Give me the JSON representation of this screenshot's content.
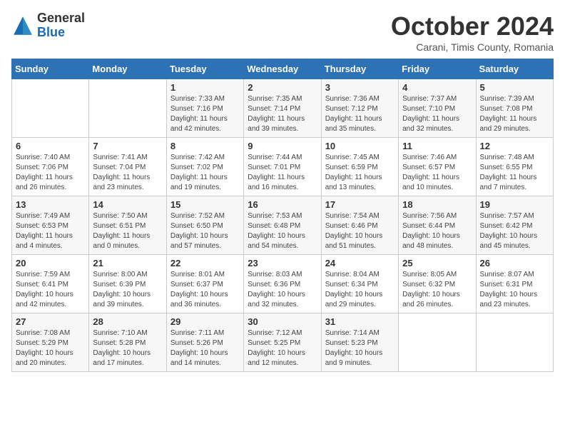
{
  "header": {
    "logo_general": "General",
    "logo_blue": "Blue",
    "title": "October 2024",
    "subtitle": "Carani, Timis County, Romania"
  },
  "days_of_week": [
    "Sunday",
    "Monday",
    "Tuesday",
    "Wednesday",
    "Thursday",
    "Friday",
    "Saturday"
  ],
  "weeks": [
    [
      {
        "num": "",
        "detail": ""
      },
      {
        "num": "",
        "detail": ""
      },
      {
        "num": "1",
        "detail": "Sunrise: 7:33 AM\nSunset: 7:16 PM\nDaylight: 11 hours and 42 minutes."
      },
      {
        "num": "2",
        "detail": "Sunrise: 7:35 AM\nSunset: 7:14 PM\nDaylight: 11 hours and 39 minutes."
      },
      {
        "num": "3",
        "detail": "Sunrise: 7:36 AM\nSunset: 7:12 PM\nDaylight: 11 hours and 35 minutes."
      },
      {
        "num": "4",
        "detail": "Sunrise: 7:37 AM\nSunset: 7:10 PM\nDaylight: 11 hours and 32 minutes."
      },
      {
        "num": "5",
        "detail": "Sunrise: 7:39 AM\nSunset: 7:08 PM\nDaylight: 11 hours and 29 minutes."
      }
    ],
    [
      {
        "num": "6",
        "detail": "Sunrise: 7:40 AM\nSunset: 7:06 PM\nDaylight: 11 hours and 26 minutes."
      },
      {
        "num": "7",
        "detail": "Sunrise: 7:41 AM\nSunset: 7:04 PM\nDaylight: 11 hours and 23 minutes."
      },
      {
        "num": "8",
        "detail": "Sunrise: 7:42 AM\nSunset: 7:02 PM\nDaylight: 11 hours and 19 minutes."
      },
      {
        "num": "9",
        "detail": "Sunrise: 7:44 AM\nSunset: 7:01 PM\nDaylight: 11 hours and 16 minutes."
      },
      {
        "num": "10",
        "detail": "Sunrise: 7:45 AM\nSunset: 6:59 PM\nDaylight: 11 hours and 13 minutes."
      },
      {
        "num": "11",
        "detail": "Sunrise: 7:46 AM\nSunset: 6:57 PM\nDaylight: 11 hours and 10 minutes."
      },
      {
        "num": "12",
        "detail": "Sunrise: 7:48 AM\nSunset: 6:55 PM\nDaylight: 11 hours and 7 minutes."
      }
    ],
    [
      {
        "num": "13",
        "detail": "Sunrise: 7:49 AM\nSunset: 6:53 PM\nDaylight: 11 hours and 4 minutes."
      },
      {
        "num": "14",
        "detail": "Sunrise: 7:50 AM\nSunset: 6:51 PM\nDaylight: 11 hours and 0 minutes."
      },
      {
        "num": "15",
        "detail": "Sunrise: 7:52 AM\nSunset: 6:50 PM\nDaylight: 10 hours and 57 minutes."
      },
      {
        "num": "16",
        "detail": "Sunrise: 7:53 AM\nSunset: 6:48 PM\nDaylight: 10 hours and 54 minutes."
      },
      {
        "num": "17",
        "detail": "Sunrise: 7:54 AM\nSunset: 6:46 PM\nDaylight: 10 hours and 51 minutes."
      },
      {
        "num": "18",
        "detail": "Sunrise: 7:56 AM\nSunset: 6:44 PM\nDaylight: 10 hours and 48 minutes."
      },
      {
        "num": "19",
        "detail": "Sunrise: 7:57 AM\nSunset: 6:42 PM\nDaylight: 10 hours and 45 minutes."
      }
    ],
    [
      {
        "num": "20",
        "detail": "Sunrise: 7:59 AM\nSunset: 6:41 PM\nDaylight: 10 hours and 42 minutes."
      },
      {
        "num": "21",
        "detail": "Sunrise: 8:00 AM\nSunset: 6:39 PM\nDaylight: 10 hours and 39 minutes."
      },
      {
        "num": "22",
        "detail": "Sunrise: 8:01 AM\nSunset: 6:37 PM\nDaylight: 10 hours and 36 minutes."
      },
      {
        "num": "23",
        "detail": "Sunrise: 8:03 AM\nSunset: 6:36 PM\nDaylight: 10 hours and 32 minutes."
      },
      {
        "num": "24",
        "detail": "Sunrise: 8:04 AM\nSunset: 6:34 PM\nDaylight: 10 hours and 29 minutes."
      },
      {
        "num": "25",
        "detail": "Sunrise: 8:05 AM\nSunset: 6:32 PM\nDaylight: 10 hours and 26 minutes."
      },
      {
        "num": "26",
        "detail": "Sunrise: 8:07 AM\nSunset: 6:31 PM\nDaylight: 10 hours and 23 minutes."
      }
    ],
    [
      {
        "num": "27",
        "detail": "Sunrise: 7:08 AM\nSunset: 5:29 PM\nDaylight: 10 hours and 20 minutes."
      },
      {
        "num": "28",
        "detail": "Sunrise: 7:10 AM\nSunset: 5:28 PM\nDaylight: 10 hours and 17 minutes."
      },
      {
        "num": "29",
        "detail": "Sunrise: 7:11 AM\nSunset: 5:26 PM\nDaylight: 10 hours and 14 minutes."
      },
      {
        "num": "30",
        "detail": "Sunrise: 7:12 AM\nSunset: 5:25 PM\nDaylight: 10 hours and 12 minutes."
      },
      {
        "num": "31",
        "detail": "Sunrise: 7:14 AM\nSunset: 5:23 PM\nDaylight: 10 hours and 9 minutes."
      },
      {
        "num": "",
        "detail": ""
      },
      {
        "num": "",
        "detail": ""
      }
    ]
  ]
}
